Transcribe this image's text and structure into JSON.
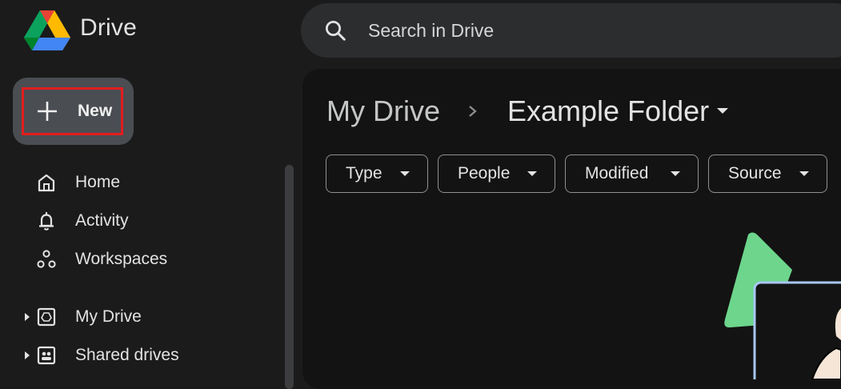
{
  "app": {
    "brand": "Drive",
    "logo_icon": "google-drive-logo"
  },
  "search": {
    "placeholder": "Search in Drive",
    "icon": "search-icon"
  },
  "sidebar": {
    "new_label": "New",
    "items": [
      {
        "label": "Home",
        "icon": "home-icon"
      },
      {
        "label": "Activity",
        "icon": "bell-icon"
      },
      {
        "label": "Workspaces",
        "icon": "workspaces-icon"
      },
      {
        "label": "My Drive",
        "icon": "my-drive-icon"
      },
      {
        "label": "Shared drives",
        "icon": "shared-drives-icon"
      }
    ]
  },
  "breadcrumb": {
    "root": "My Drive",
    "current": "Example Folder"
  },
  "filters": [
    "Type",
    "People",
    "Modified",
    "Source"
  ],
  "colors": {
    "background": "#1b1b1b",
    "main_panel": "#131313",
    "search_bg": "#2c2d2f",
    "new_button_bg": "#4a4d52",
    "highlight_border": "#e21d1d",
    "illustration_green": "#6dd58c",
    "illustration_blue": "#a8c7fa"
  }
}
